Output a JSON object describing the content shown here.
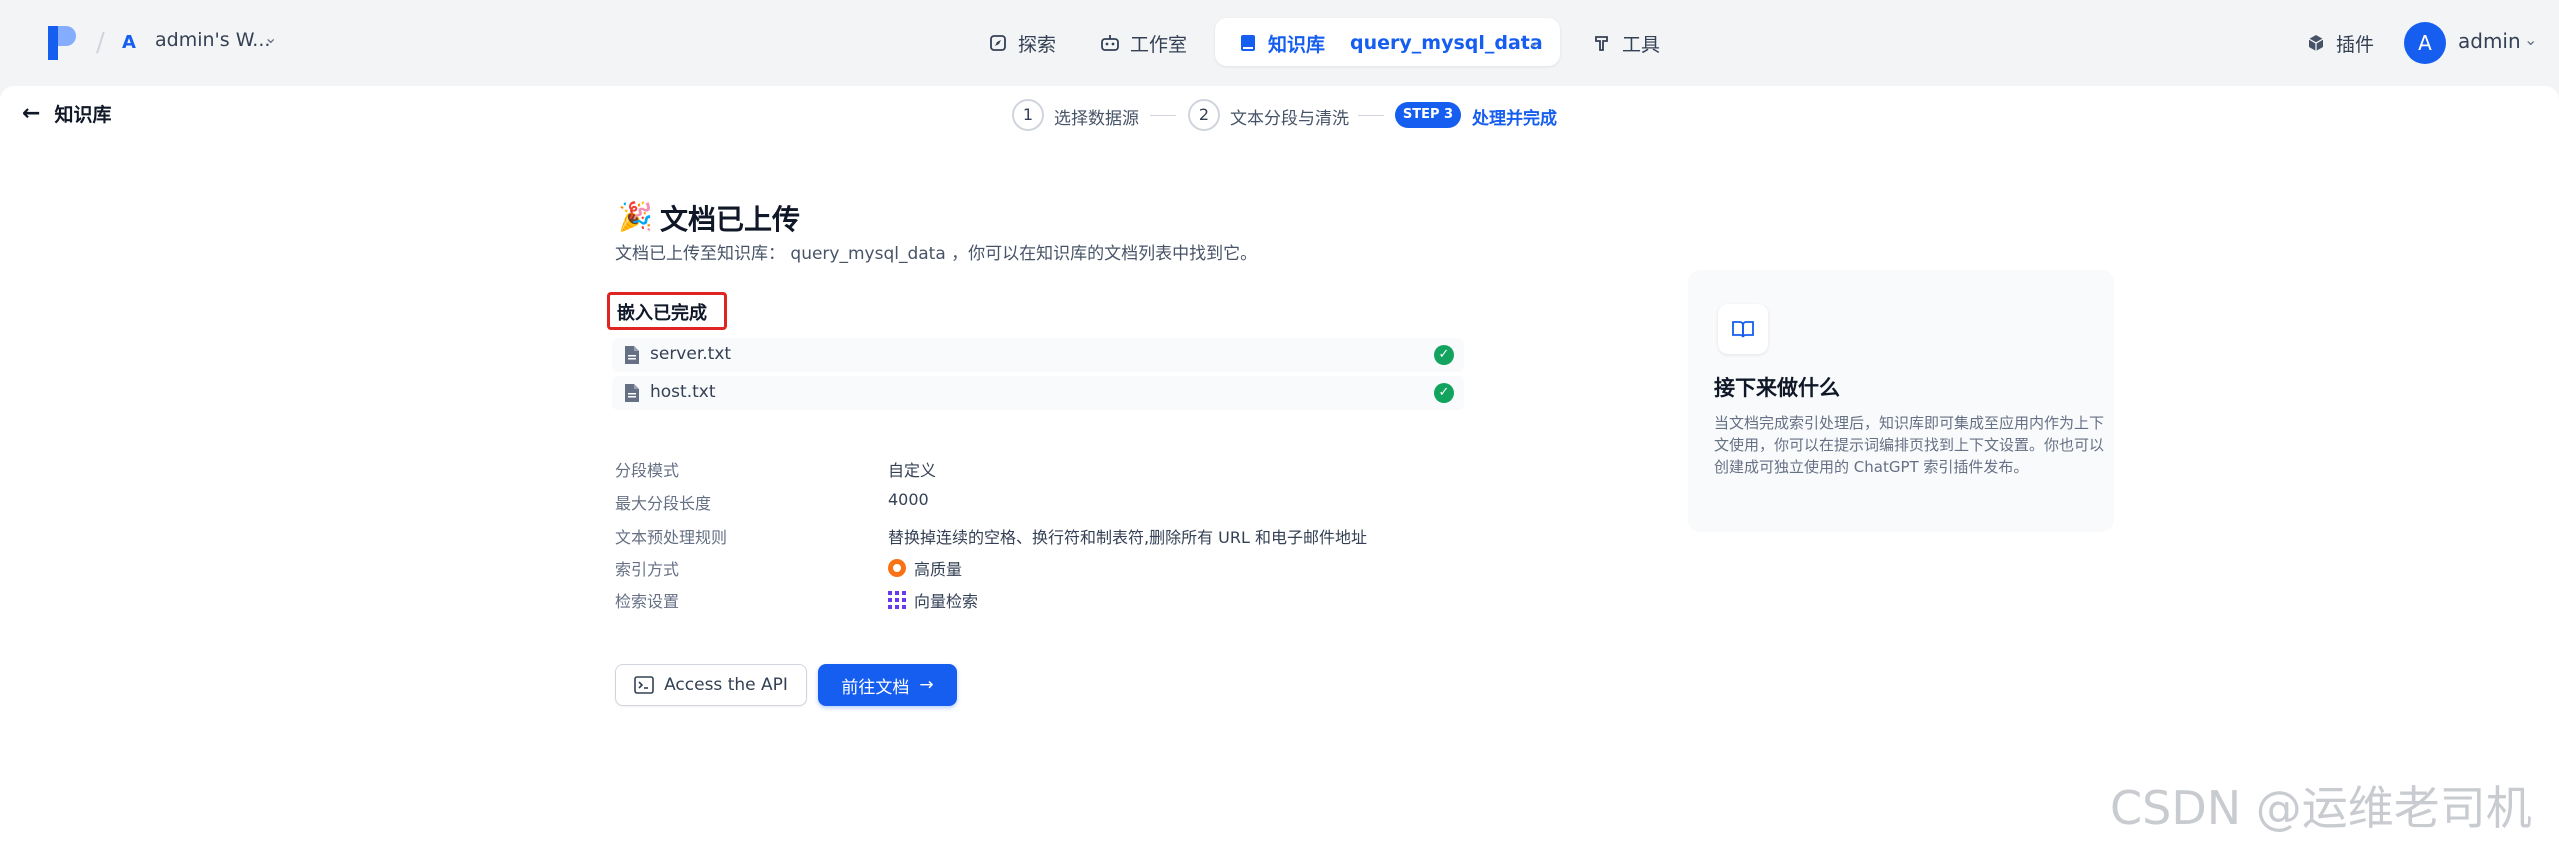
{
  "nav": {
    "workspace_initial": "A",
    "workspace_name": "admin's W...",
    "explore": "探索",
    "studio": "工作室",
    "knowledge": "知识库",
    "knowledge_selected": "query_mysql_data",
    "tools": "工具",
    "plugins": "插件",
    "user_initial": "A",
    "user_name": "admin"
  },
  "page": {
    "back_label": "知识库",
    "steps": [
      {
        "number": "1",
        "label": "选择数据源"
      },
      {
        "number": "2",
        "label": "文本分段与清洗"
      },
      {
        "number": "STEP 3",
        "label": "处理并完成"
      }
    ],
    "emoji": "🎉",
    "title": "文档已上传",
    "subtitle": "文档已上传至知识库： query_mysql_data ，你可以在知识库的文档列表中找到它。",
    "embed_status": "嵌入已完成",
    "files": [
      {
        "name": "server.txt",
        "status": "done"
      },
      {
        "name": "host.txt",
        "status": "done"
      }
    ],
    "settings": [
      {
        "key": "分段模式",
        "value": "自定义"
      },
      {
        "key": "最大分段长度",
        "value": "4000"
      },
      {
        "key": "文本预处理规则",
        "value": "替换掉连续的空格、换行符和制表符,删除所有 URL 和电子邮件地址"
      },
      {
        "key": "索引方式",
        "value": "高质量"
      },
      {
        "key": "检索设置",
        "value": "向量检索"
      }
    ],
    "api_button": "Access the API",
    "go_button": "前往文档"
  },
  "side": {
    "title": "接下来做什么",
    "description": "当文档完成索引处理后，知识库即可集成至应用内作为上下文使用，你可以在提示词编排页找到上下文设置。你也可以创建成可独立使用的 ChatGPT 索引插件发布。"
  },
  "watermark": "CSDN @运维老司机",
  "colors": {
    "accent": "#155eef",
    "success": "#12a35e",
    "highlight": "#e02424"
  }
}
